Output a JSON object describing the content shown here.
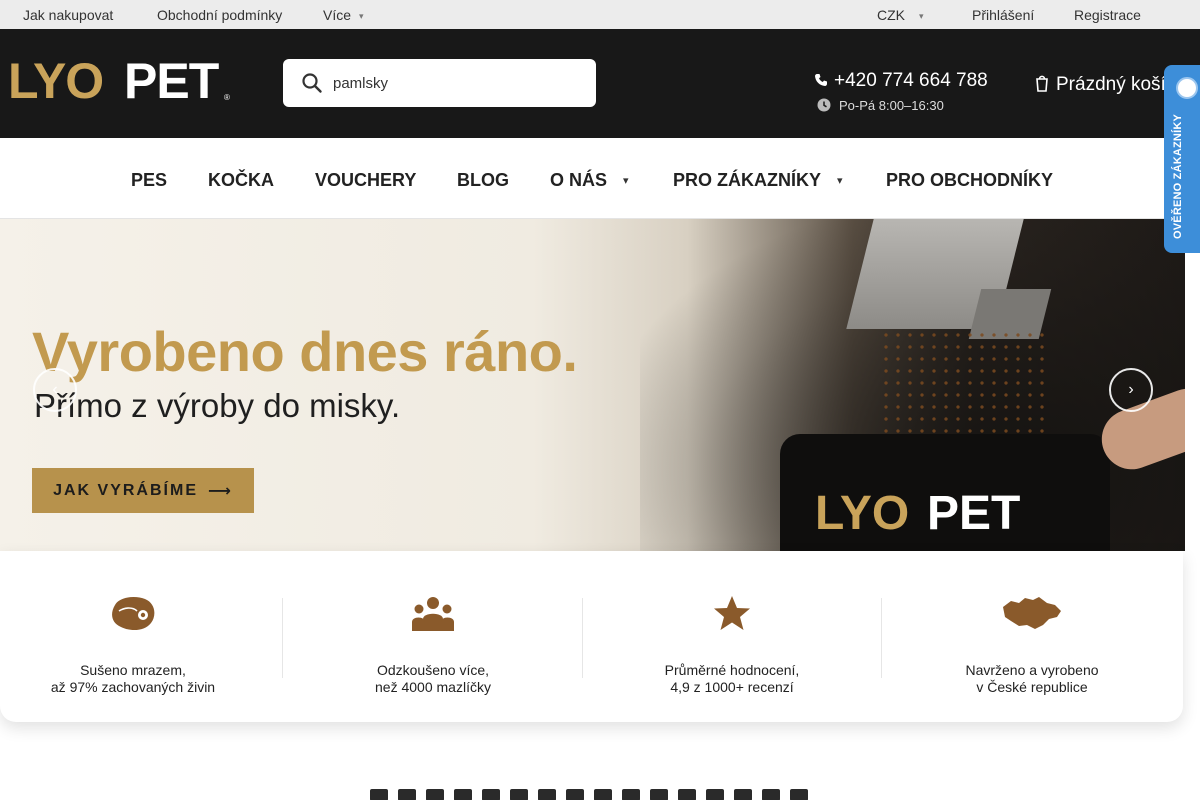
{
  "topbar": {
    "links": [
      "Jak nakupovat",
      "Obchodní podmínky",
      "Více"
    ],
    "currency": "CZK",
    "login": "Přihlášení",
    "register": "Registrace"
  },
  "header": {
    "logo_text": "LYOPET",
    "search_value": "pamlsky",
    "phone": "+420 774 664 788",
    "hours": "Po-Pá 8:00–16:30",
    "cart": "Prázdný košík"
  },
  "badge": {
    "text": "OVĚŘENO ZÁKAZNÍKY"
  },
  "nav": {
    "items": [
      "PES",
      "KOČKA",
      "VOUCHERY",
      "BLOG",
      "O NÁS",
      "PRO ZÁKAZNÍKY",
      "PRO OBCHODNÍKY"
    ]
  },
  "hero": {
    "title": "Vyrobeno dnes ráno.",
    "subtitle": "Přímo z výroby do misky.",
    "button": "JAK VYRÁBÍME",
    "bag_logo": "LYOPET"
  },
  "features": [
    {
      "icon": "meat-icon",
      "line1": "Sušeno mrazem,",
      "line2": "až 97% zachovaných živin"
    },
    {
      "icon": "group-icon",
      "line1": "Odzkoušeno více,",
      "line2": "než 4000 mazlíčky"
    },
    {
      "icon": "star-icon",
      "line1": "Průměrné hodnocení,",
      "line2": "4,9 z 1000+ recenzí"
    },
    {
      "icon": "czech-map-icon",
      "line1": "Navrženo a vyrobeno",
      "line2": "v České republice"
    }
  ],
  "colors": {
    "accent": "#b7924c",
    "header_bg": "#181818",
    "badge_blue": "#3d8ed9",
    "icon_brown": "#8a5a2b"
  }
}
